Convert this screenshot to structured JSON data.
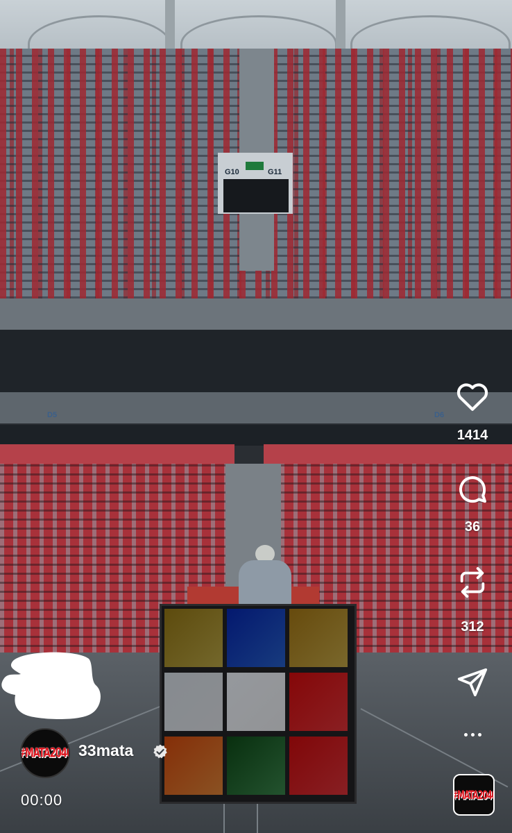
{
  "post": {
    "username": "33mata",
    "verified": true,
    "avatar_text": "#MATA2040",
    "timestamp": "00:00",
    "sound_thumbnail_text": "#MATA2040"
  },
  "stats": {
    "likes": "1414",
    "comments": "36",
    "reposts": "312"
  },
  "scene": {
    "gate_left": "G10",
    "gate_right": "G11",
    "section_left": "D5",
    "section_right": "D6"
  },
  "icons": {
    "like": "heart-icon",
    "comment": "comment-bubble-icon",
    "repost": "repost-arrows-icon",
    "share": "paper-plane-icon",
    "more": "more-dots-icon",
    "verified": "verified-badge-icon"
  },
  "colors": {
    "seat_red": "#a8313a",
    "cube": [
      "#9a8a3a",
      "#1f4fa8",
      "#a28a3a",
      "#b9bcc0",
      "#c3c5c8",
      "#b82a2e",
      "#b86d2e",
      "#2f6e3e",
      "#b52a2f"
    ]
  }
}
